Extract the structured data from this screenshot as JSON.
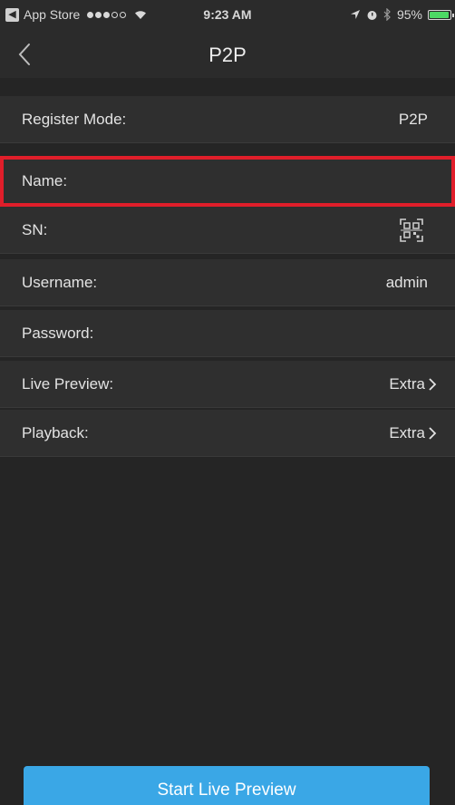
{
  "status_bar": {
    "back_app": "App Store",
    "time": "9:23 AM",
    "battery_percent": "95%",
    "battery_level": 0.95
  },
  "nav": {
    "title": "P2P"
  },
  "rows": [
    {
      "label": "Register Mode:",
      "value": "P2P"
    },
    {
      "label": "Name:",
      "value": ""
    },
    {
      "label": "SN:",
      "value": ""
    },
    {
      "label": "Username:",
      "value": "admin"
    },
    {
      "label": "Password:",
      "value": ""
    },
    {
      "label": "Live Preview:",
      "value": "Extra"
    },
    {
      "label": "Playback:",
      "value": "Extra"
    }
  ],
  "start_button": "Start Live Preview",
  "colors": {
    "accent": "#3aa7e6",
    "highlight": "#e01e2a",
    "background": "#252525",
    "row_background": "#2f2f2f"
  }
}
